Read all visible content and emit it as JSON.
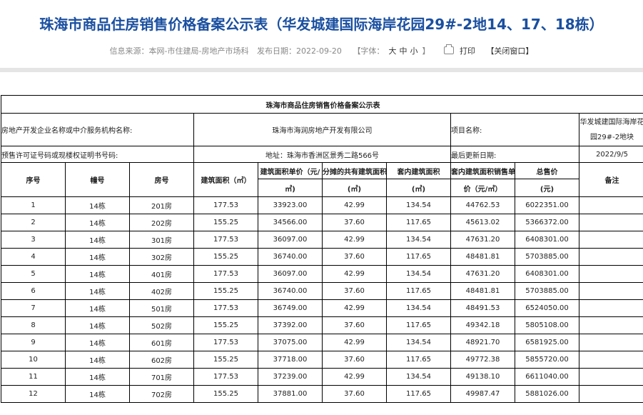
{
  "header": {
    "title": "珠海市商品住房销售价格备案公示表（华发城建国际海岸花园29#-2地14、17、18栋）",
    "source": "信息来源：本网-市住建局-房地产市场科",
    "date": "发布日期：2022-09-20",
    "font_open": "【字体：",
    "font_large": "大",
    "font_medium": "中",
    "font_small": "小",
    "font_close": "】",
    "print": "打印",
    "close_window": "【关闭窗口】"
  },
  "table": {
    "caption": "珠海市商品住房销售价格备案公示表",
    "info": {
      "developer_label": "房地产开发企业名称或中介服务机构名称:",
      "developer_value": "珠海市海润房地产开发有限公司",
      "project_label": "项目名称:",
      "project_value": "华发城建国际海岸花园29#-2地块",
      "permit_label": "预售许可证号码或现楼权证明书号码:",
      "address": "地址：珠海市香洲区景秀二路566号",
      "update_label": "最后更新日期:",
      "update_value": "2022/9/5"
    },
    "headers": {
      "no": "序号",
      "building": "幢号",
      "room": "房号",
      "area": "建筑面积（㎡）",
      "unit_price_a": "建筑面积单价（元/",
      "unit_price_b": "㎡)",
      "shared_area_a": "分摊的共有建筑面积",
      "shared_area_b": "(㎡)",
      "inner_area_a": "套内建筑面积",
      "inner_area_b": "(㎡)",
      "inner_price_a": "套内建筑面积销售单",
      "inner_price_b": "价（元/㎡）",
      "total_a": "总售价",
      "total_b": "(元)",
      "remark": "备注"
    },
    "rows": [
      {
        "no": "1",
        "building": "14栋",
        "room": "201房",
        "area": "177.53",
        "unit": "33923.00",
        "shared": "42.99",
        "inner": "134.54",
        "inner_price": "44762.53",
        "total": "6022351.00",
        "remark": ""
      },
      {
        "no": "2",
        "building": "14栋",
        "room": "202房",
        "area": "155.25",
        "unit": "34566.00",
        "shared": "37.60",
        "inner": "117.65",
        "inner_price": "45613.02",
        "total": "5366372.00",
        "remark": ""
      },
      {
        "no": "3",
        "building": "14栋",
        "room": "301房",
        "area": "177.53",
        "unit": "36097.00",
        "shared": "42.99",
        "inner": "134.54",
        "inner_price": "47631.20",
        "total": "6408301.00",
        "remark": ""
      },
      {
        "no": "4",
        "building": "14栋",
        "room": "302房",
        "area": "155.25",
        "unit": "36740.00",
        "shared": "37.60",
        "inner": "117.65",
        "inner_price": "48481.81",
        "total": "5703885.00",
        "remark": ""
      },
      {
        "no": "5",
        "building": "14栋",
        "room": "401房",
        "area": "177.53",
        "unit": "36097.00",
        "shared": "42.99",
        "inner": "134.54",
        "inner_price": "47631.20",
        "total": "6408301.00",
        "remark": ""
      },
      {
        "no": "6",
        "building": "14栋",
        "room": "402房",
        "area": "155.25",
        "unit": "36740.00",
        "shared": "37.60",
        "inner": "117.65",
        "inner_price": "48481.81",
        "total": "5703885.00",
        "remark": ""
      },
      {
        "no": "7",
        "building": "14栋",
        "room": "501房",
        "area": "177.53",
        "unit": "36749.00",
        "shared": "42.99",
        "inner": "134.54",
        "inner_price": "48491.53",
        "total": "6524050.00",
        "remark": ""
      },
      {
        "no": "8",
        "building": "14栋",
        "room": "502房",
        "area": "155.25",
        "unit": "37392.00",
        "shared": "37.60",
        "inner": "117.65",
        "inner_price": "49342.18",
        "total": "5805108.00",
        "remark": ""
      },
      {
        "no": "9",
        "building": "14栋",
        "room": "601房",
        "area": "177.53",
        "unit": "37075.00",
        "shared": "42.99",
        "inner": "134.54",
        "inner_price": "48921.70",
        "total": "6581925.00",
        "remark": ""
      },
      {
        "no": "10",
        "building": "14栋",
        "room": "602房",
        "area": "155.25",
        "unit": "37718.00",
        "shared": "37.60",
        "inner": "117.65",
        "inner_price": "49772.38",
        "total": "5855720.00",
        "remark": ""
      },
      {
        "no": "11",
        "building": "14栋",
        "room": "701房",
        "area": "177.53",
        "unit": "37239.00",
        "shared": "42.99",
        "inner": "134.54",
        "inner_price": "49138.10",
        "total": "6611040.00",
        "remark": ""
      },
      {
        "no": "12",
        "building": "14栋",
        "room": "702房",
        "area": "155.25",
        "unit": "37881.00",
        "shared": "37.60",
        "inner": "117.65",
        "inner_price": "49987.47",
        "total": "5881026.00",
        "remark": ""
      }
    ]
  }
}
